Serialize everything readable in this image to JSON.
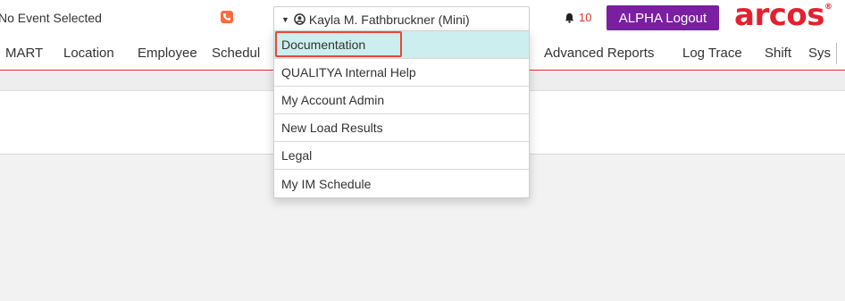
{
  "header": {
    "event_status": "No Event Selected",
    "user_name": "Kayla M. Fathbruckner (Mini)",
    "notification_count": "10",
    "logout_label": "ALPHA Logout",
    "logo_text": "arcos",
    "logo_mark": "®"
  },
  "nav": {
    "items": [
      "MART",
      "Location",
      "Employee",
      "Schedul",
      "Advanced Reports",
      "Log Trace",
      "Shift",
      "Sys"
    ]
  },
  "user_menu": {
    "items": [
      "Documentation",
      "QUALITYA Internal Help",
      "My Account Admin",
      "New Load Results",
      "Legal",
      "My IM Schedule"
    ],
    "active_index": 0
  },
  "colors": {
    "brand_red": "#e4202f",
    "logout_purple": "#7a1fa2",
    "active_item_bg": "#cdeeee",
    "highlight_border": "#e8483a",
    "phone_orange": "#ff6a3d"
  },
  "icons": {
    "phone": "phone-icon",
    "user": "user-circle-icon",
    "bell": "bell-icon",
    "caret": "caret-down-icon"
  }
}
